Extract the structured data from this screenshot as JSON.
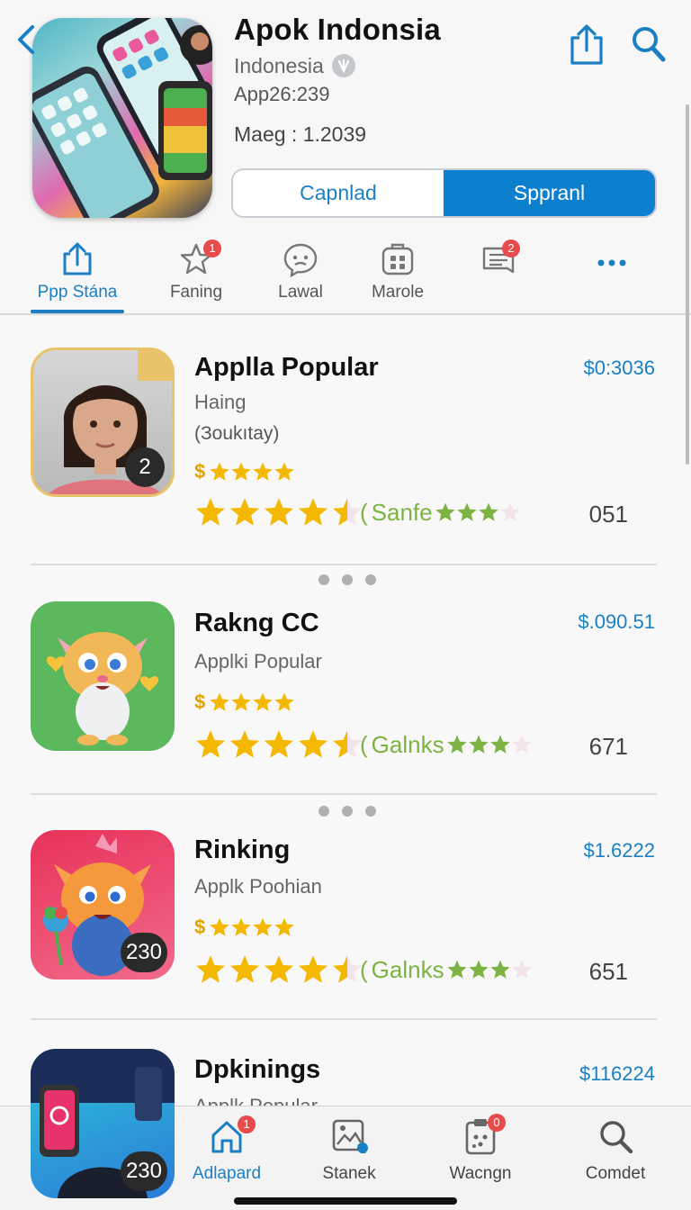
{
  "header": {
    "title": "Apok Indonsia",
    "country": "Indonesia",
    "meta_line1": "App26:239",
    "meta_line2": "Maeg : 1.2039",
    "button_left": "Capnlad",
    "button_right": "Sppranl",
    "icons": {
      "back": "chevron-left-icon",
      "verified": "verified-badge-icon",
      "share": "share-icon",
      "search": "search-icon"
    }
  },
  "tabs": [
    {
      "label": "Ppp Stána",
      "icon": "share-icon",
      "active": true
    },
    {
      "label": "Faning",
      "icon": "star-icon",
      "badge": "1"
    },
    {
      "label": "Lawal",
      "icon": "chat-face-icon"
    },
    {
      "label": "Marole",
      "icon": "grid-box-icon"
    },
    {
      "label": "",
      "icon": "list-icon",
      "badge": "2"
    },
    {
      "label": "",
      "icon": "more-icon"
    }
  ],
  "items": [
    {
      "name": "Applla Popular",
      "subtitle": "Haing",
      "subtitle2": "(Зoukıtay)",
      "price": "$0:3036",
      "dollar": "$",
      "tag": "Sanfe",
      "count": "051",
      "badge": "2",
      "rating": 4.5
    },
    {
      "name": "Rakng CC",
      "subtitle": "Applki Popular",
      "price": "$.090.51",
      "dollar": "$",
      "tag": "Galnks",
      "count": "671",
      "rating": 4.5
    },
    {
      "name": "Rinking",
      "subtitle": "Applk Poohian",
      "price": "$1.6222",
      "dollar": "$",
      "tag": "Galnks",
      "count": "651",
      "badge": "230",
      "rating": 4.5
    },
    {
      "name": "Dpkinings",
      "subtitle": "Applk Popular",
      "price": "$116224",
      "badge": "230"
    }
  ],
  "bottom_nav": [
    {
      "label": "Adlapard",
      "icon": "home-icon",
      "badge": "1",
      "active": true
    },
    {
      "label": "Stanek",
      "icon": "image-edit-icon"
    },
    {
      "label": "Wacngn",
      "icon": "clipboard-icon",
      "badge": "0"
    },
    {
      "label": "Comdet",
      "icon": "search-icon"
    }
  ],
  "colors": {
    "accent": "#1a7fc3",
    "badge": "#e84b4b",
    "star": "#f5b800",
    "tag": "#7cb342"
  }
}
